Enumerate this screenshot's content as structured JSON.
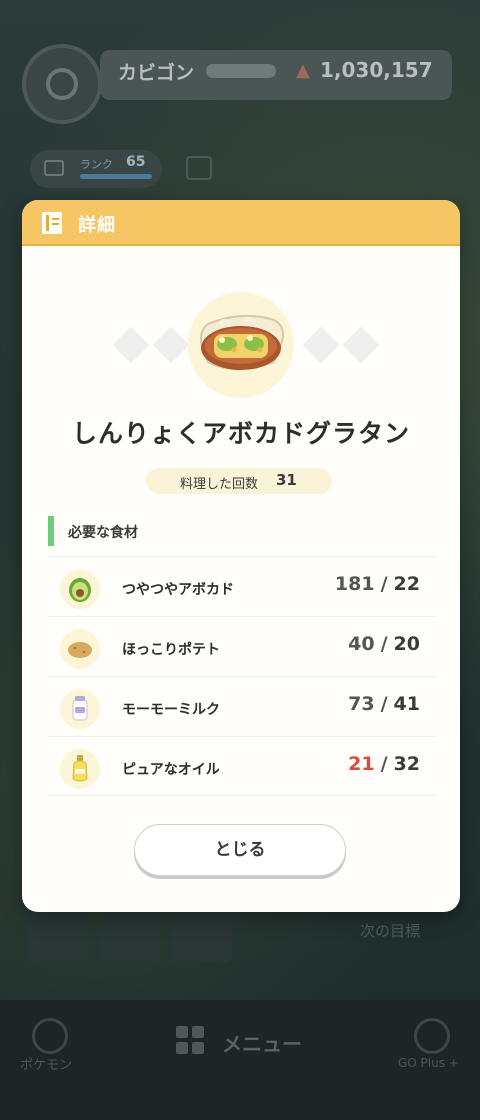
{
  "background": {
    "trainer_name": "カビゴン",
    "energy": "1,030,157",
    "rank_label": "ランク",
    "rank_value": "65",
    "next_label": "次の目標",
    "footer": {
      "pokemon_label": "ポケモン",
      "menu_label": "メニュー",
      "goplus_label": "GO Plus +"
    }
  },
  "modal": {
    "header_title": "詳細",
    "dish_name": "しんりょくアボカドグラタン",
    "cook_count_label": "料理した回数",
    "cook_count": "31",
    "section_title": "必要な食材",
    "ingredients": [
      {
        "name": "つやつやアボカド",
        "have": "181",
        "need": "22",
        "short": false,
        "icon": "avocado-icon"
      },
      {
        "name": "ほっこりポテト",
        "have": "40",
        "need": "20",
        "short": false,
        "icon": "potato-icon"
      },
      {
        "name": "モーモーミルク",
        "have": "73",
        "need": "41",
        "short": false,
        "icon": "milk-bottle-icon"
      },
      {
        "name": "ピュアなオイル",
        "have": "21",
        "need": "32",
        "short": true,
        "icon": "oil-bottle-icon"
      }
    ],
    "separator": "/",
    "close_label": "とじる"
  },
  "colors": {
    "header": "#f6c564",
    "shortage": "#d94c3a",
    "section_accent": "#6cce7a"
  }
}
